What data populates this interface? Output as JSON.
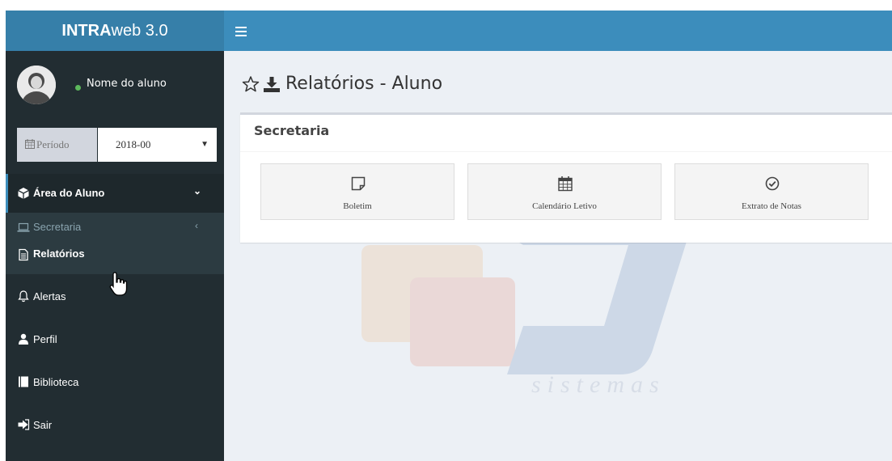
{
  "brand": {
    "bold": "INTRA",
    "rest": "web 3.0"
  },
  "user": {
    "name": "Nome do aluno",
    "status": "online"
  },
  "period": {
    "label": "Período",
    "value": "2018-00"
  },
  "sidebar": {
    "area": "Área do Aluno",
    "secretaria": "Secretaria",
    "relatorios": "Relatórios",
    "alertas": "Alertas",
    "perfil": "Perfil",
    "biblioteca": "Biblioteca",
    "sair": "Sair"
  },
  "main": {
    "title": "Relatórios - Aluno",
    "box_title": "Secretaria",
    "tiles": [
      "Boletim",
      "Calendário Letivo",
      "Extrato de Notas"
    ],
    "watermark_text": "sistemas"
  },
  "colors": {
    "topbar": "#3c8dbc",
    "logo_bg": "#367fa9",
    "sidebar": "#222d32",
    "content_bg": "#ecf0f5",
    "status_dot": "#5cb85c"
  }
}
